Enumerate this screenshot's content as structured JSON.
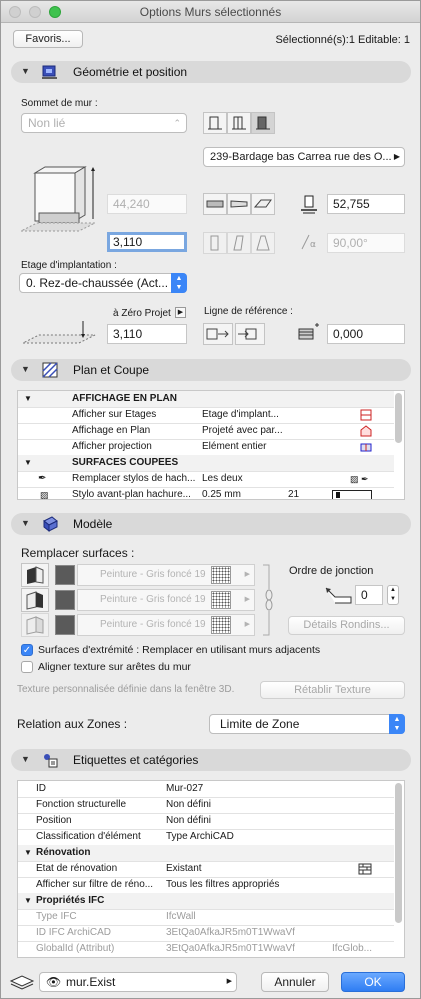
{
  "window": {
    "title": "Options Murs sélectionnés"
  },
  "toolbar": {
    "favorites_label": "Favoris...",
    "selection_status": "Sélectionné(s):1 Editable: 1"
  },
  "geometry": {
    "section_label": "Géométrie et position",
    "wall_top_label": "Sommet de mur :",
    "wall_top_value": "Non lié",
    "wall_height": "44,240",
    "wall_offset": "3,110",
    "story_label": "Etage d'implantation :",
    "story_value": "0. Rez-de-chaussée (Act...",
    "zero_label": "à Zéro Projet",
    "zero_value": "3,110",
    "profile_value": "239-Bardage bas Carrea rue des O...",
    "thickness": "52,755",
    "angle": "90,00°",
    "ref_line_label": "Ligne de référence :",
    "ref_offset": "0,000"
  },
  "plan": {
    "section_label": "Plan et Coupe",
    "rows": [
      {
        "name": "AFFICHAGE EN PLAN",
        "value": "",
        "group": true
      },
      {
        "name": "Afficher sur Etages",
        "value": "Etage d'implant...",
        "group": false
      },
      {
        "name": "Affichage en Plan",
        "value": "Projeté avec par...",
        "group": false
      },
      {
        "name": "Afficher projection",
        "value": "Elément entier",
        "group": false
      },
      {
        "name": "SURFACES COUPEES",
        "value": "",
        "group": true
      },
      {
        "name": "Remplacer stylos de hach...",
        "value": "Les deux",
        "group": false
      },
      {
        "name": "Stylo avant-plan hachure...",
        "value": "0.25 mm",
        "extra": "21",
        "group": false
      }
    ]
  },
  "model": {
    "section_label": "Modèle",
    "override_label": "Remplacer surfaces :",
    "materials": [
      "Peinture - Gris foncé 19",
      "Peinture - Gris foncé 19",
      "Peinture - Gris foncé 19"
    ],
    "junction_label": "Ordre de jonction",
    "junction_value": "0",
    "log_details_label": "Détails Rondins...",
    "end_surfaces_label": "Surfaces d'extrémité : Remplacer en utilisant murs adjacents",
    "align_texture_label": "Aligner texture sur arêtes du mur",
    "texture_note": "Texture personnalisée définie dans la fenêtre 3D.",
    "reset_texture_label": "Rétablir Texture"
  },
  "zones": {
    "label": "Relation aux Zones :",
    "value": "Limite de Zone"
  },
  "tags": {
    "section_label": "Etiquettes et catégories",
    "rows": [
      {
        "name": "ID",
        "value": "Mur-027",
        "group": false,
        "dim": false
      },
      {
        "name": "Fonction structurelle",
        "value": "Non défini",
        "group": false,
        "dim": false
      },
      {
        "name": "Position",
        "value": "Non défini",
        "group": false,
        "dim": false
      },
      {
        "name": "Classification d'élément",
        "value": "Type ArchiCAD",
        "group": false,
        "dim": false
      },
      {
        "name": "Rénovation",
        "value": "",
        "group": true,
        "dim": false
      },
      {
        "name": "Etat de rénovation",
        "value": "Existant",
        "group": false,
        "dim": false
      },
      {
        "name": "Afficher sur filtre de réno...",
        "value": "Tous les filtres appropriés",
        "group": false,
        "dim": false
      },
      {
        "name": "Propriétés IFC",
        "value": "",
        "group": true,
        "dim": false
      },
      {
        "name": "Type IFC",
        "value": "IfcWall",
        "group": false,
        "dim": true
      },
      {
        "name": "ID IFC ArchiCAD",
        "value": "3EtQa0AfkaJR5m0T1WwaVf",
        "group": false,
        "dim": true
      },
      {
        "name": "GlobalId (Attribut)",
        "value": "3EtQa0AfkaJR5m0T1WwaVf",
        "extra": "IfcGlob...",
        "group": false,
        "dim": true
      }
    ]
  },
  "footer": {
    "layer_value": "mur.Exist",
    "cancel_label": "Annuler",
    "ok_label": "OK"
  },
  "colors": {
    "accent": "#3b86f7",
    "section_bg": "#d9d9d9"
  }
}
